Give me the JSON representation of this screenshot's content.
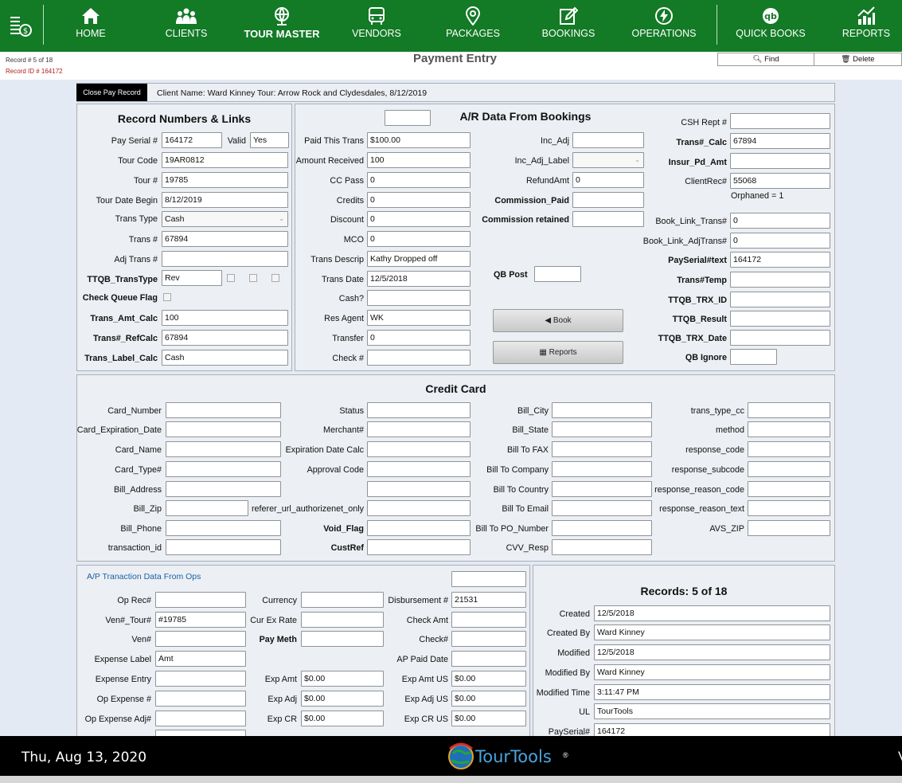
{
  "nav": {
    "items": [
      "HOME",
      "CLIENTS",
      "TOUR MASTER",
      "VENDORS",
      "PACKAGES",
      "BOOKINGS",
      "OPERATIONS",
      "QUICK BOOKS",
      "REPORTS"
    ],
    "active": "TOUR MASTER",
    "bg_color": "#137a26"
  },
  "header": {
    "record_pos": "Record # 5 of 18",
    "record_id": "Record ID # 164172",
    "title": "Payment Entry",
    "find_label": "Find",
    "delete_label": "Delete"
  },
  "client_bar": {
    "close_label": "Close Pay Record",
    "text": "Client Name: Ward Kinney Tour: Arrow Rock and Clydesdales, 8/12/2019"
  },
  "record_links": {
    "title": "Record Numbers & Links",
    "pay_serial": {
      "label": "Pay Serial #",
      "value": "164172"
    },
    "valid": {
      "label": "Valid",
      "value": "Yes"
    },
    "tour_code": {
      "label": "Tour Code",
      "value": "19AR0812"
    },
    "tour_num": {
      "label": "Tour #",
      "value": "19785"
    },
    "tour_date": {
      "label": "Tour Date Begin",
      "value": "8/12/2019"
    },
    "trans_type": {
      "label": "Trans Type",
      "value": "Cash"
    },
    "trans_num": {
      "label": "Trans #",
      "value": "67894"
    },
    "adj_trans": {
      "label": "Adj Trans #",
      "value": ""
    },
    "ttqb_transtype": {
      "label": "TTQB_TransType",
      "value": "Rev"
    },
    "check_queue": {
      "label": "Check Queue Flag"
    },
    "trans_amt_calc": {
      "label": "Trans_Amt_Calc",
      "value": "100"
    },
    "trans_refcalc": {
      "label": "Trans#_RefCalc",
      "value": "67894"
    },
    "trans_label_calc": {
      "label": "Trans_Label_Calc",
      "value": "Cash"
    }
  },
  "ar": {
    "title": "A/R Data From Bookings",
    "top_box": "",
    "paid_this_trans": {
      "label": "Paid This Trans",
      "value": "$100.00"
    },
    "amount_received": {
      "label": "Amount Received",
      "value": "100"
    },
    "cc_pass": {
      "label": "CC Pass",
      "value": "0"
    },
    "credits": {
      "label": "Credits",
      "value": "0"
    },
    "discount": {
      "label": "Discount",
      "value": "0"
    },
    "mco": {
      "label": "MCO",
      "value": "0"
    },
    "trans_descrip": {
      "label": "Trans Descrip",
      "value": "Kathy Dropped off"
    },
    "trans_date": {
      "label": "Trans Date",
      "value": "12/5/2018"
    },
    "cash": {
      "label": "Cash?",
      "value": ""
    },
    "res_agent": {
      "label": "Res Agent",
      "value": "WK"
    },
    "transfer": {
      "label": "Transfer",
      "value": "0"
    },
    "check_num": {
      "label": "Check #",
      "value": ""
    },
    "inc_adj": {
      "label": "Inc_Adj",
      "value": ""
    },
    "inc_adj_label": {
      "label": "Inc_Adj_Label",
      "value": ""
    },
    "refund_amt": {
      "label": "RefundAmt",
      "value": "0"
    },
    "commission_paid": {
      "label": "Commission_Paid",
      "value": ""
    },
    "commission_retained": {
      "label": "Commission retained",
      "value": ""
    },
    "qb_post": {
      "label": "QB Post",
      "value": ""
    },
    "book_label": "Book",
    "reports_label": "Reports",
    "csh_rept": {
      "label": "CSH Rept #",
      "value": ""
    },
    "trans_calc": {
      "label": "Trans#_Calc",
      "value": "67894"
    },
    "insur_pd_amt": {
      "label": "Insur_Pd_Amt",
      "value": ""
    },
    "client_rec": {
      "label": "ClientRec#",
      "value": "55068"
    },
    "orphaned": "Orphaned = 1",
    "book_link_trans": {
      "label": "Book_Link_Trans#",
      "value": "0"
    },
    "book_link_adjtrans": {
      "label": "Book_Link_AdjTrans#",
      "value": "0"
    },
    "payserial_text": {
      "label": "PaySerial#text",
      "value": "164172"
    },
    "trans_temp": {
      "label": "Trans#Temp",
      "value": ""
    },
    "ttqb_trx_id": {
      "label": "TTQB_TRX_ID",
      "value": ""
    },
    "ttqb_result": {
      "label": "TTQB_Result",
      "value": ""
    },
    "ttqb_trx_date": {
      "label": "TTQB_TRX_Date",
      "value": ""
    },
    "qb_ignore": {
      "label": "QB Ignore",
      "value": ""
    }
  },
  "cc": {
    "title": "Credit Card",
    "col1": [
      "Card_Number",
      "Card_Expiration_Date",
      "Card_Name",
      "Card_Type#",
      "Bill_Address",
      "Bill_Zip",
      "Bill_Phone",
      "transaction_id"
    ],
    "col2": [
      "Status",
      "Merchant#",
      "Expiration Date Calc",
      "Approval Code",
      "",
      "referer_url_authorizenet_only",
      "Void_Flag",
      "CustRef"
    ],
    "col3": [
      "Bill_City",
      "Bill_State",
      "Bill To FAX",
      "Bill To Company",
      "Bill To Country",
      "Bill To Email",
      "Bill To PO_Number",
      "CVV_Resp"
    ],
    "col4": [
      "trans_type_cc",
      "method",
      "response_code",
      "response_subcode",
      "response_reason_code",
      "response_reason_text",
      "AVS_ZIP"
    ]
  },
  "ap": {
    "title": "A/P Tranaction Data From Ops",
    "top_box": "",
    "op_rec": {
      "label": "Op Rec#",
      "value": ""
    },
    "ven_tour": {
      "label": "Ven#_Tour#",
      "value": "#19785"
    },
    "ven": {
      "label": "Ven#",
      "value": ""
    },
    "expense_label": {
      "label": "Expense Label",
      "value": "Amt"
    },
    "expense_entry": {
      "label": "Expense Entry",
      "value": ""
    },
    "op_expense": {
      "label": "Op Expense #",
      "value": ""
    },
    "op_expense_adj": {
      "label": "Op Expense Adj#",
      "value": ""
    },
    "currency": {
      "label": "Currency",
      "value": ""
    },
    "cur_ex_rate": {
      "label": "Cur Ex Rate",
      "value": ""
    },
    "pay_meth": {
      "label": "Pay Meth",
      "value": ""
    },
    "exp_amt": {
      "label": "Exp Amt",
      "value": "$0.00"
    },
    "exp_adj": {
      "label": "Exp Adj",
      "value": "$0.00"
    },
    "exp_cr": {
      "label": "Exp CR",
      "value": "$0.00"
    },
    "disbursement": {
      "label": "Disbursement #",
      "value": "21531"
    },
    "check_amt": {
      "label": "Check Amt",
      "value": ""
    },
    "check_no": {
      "label": "Check#",
      "value": ""
    },
    "ap_paid_date": {
      "label": "AP Paid Date",
      "value": ""
    },
    "exp_amt_us": {
      "label": "Exp Amt US",
      "value": "$0.00"
    },
    "exp_adj_us": {
      "label": "Exp Adj US",
      "value": "$0.00"
    },
    "exp_cr_us": {
      "label": "Exp CR US",
      "value": "$0.00"
    }
  },
  "records": {
    "title": "Records: 5 of 18",
    "created": {
      "label": "Created",
      "value": "12/5/2018"
    },
    "created_by": {
      "label": "Created By",
      "value": "Ward Kinney"
    },
    "modified": {
      "label": "Modified",
      "value": "12/5/2018"
    },
    "modified_by": {
      "label": "Modified By",
      "value": "Ward Kinney"
    },
    "modified_time": {
      "label": "Modified Time",
      "value": "3:11:47 PM"
    },
    "ul": {
      "label": "UL",
      "value": "TourTools"
    },
    "payserial": {
      "label": "PaySerial#",
      "value": "164172"
    }
  },
  "footer": {
    "date": "Thu, Aug 13, 2020",
    "brand": "TourTools",
    "reg": "®",
    "edge_char": "V"
  }
}
